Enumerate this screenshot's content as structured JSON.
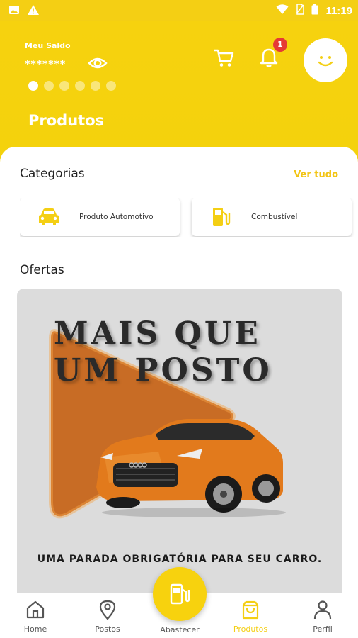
{
  "status_bar": {
    "time": "11:19"
  },
  "header": {
    "saldo_label": "Meu Saldo",
    "saldo_value": "*******",
    "notification_count": "1",
    "page_title": "Produtos",
    "carousel_total": 6,
    "carousel_active": 1
  },
  "categories": {
    "title": "Categorias",
    "see_all": "Ver tudo",
    "items": [
      {
        "label": "Produto Automotivo",
        "icon": "car-icon"
      },
      {
        "label": "Combustível",
        "icon": "fuel-pump-icon"
      }
    ]
  },
  "offers": {
    "title": "Ofertas",
    "banner_headline_line1": "MAIS QUE",
    "banner_headline_line2": "UM POSTO",
    "banner_caption": "UMA PARADA OBRIGATÓRIA PARA SEU CARRO."
  },
  "bottom_nav": {
    "items": [
      {
        "label": "Home",
        "icon": "home-icon"
      },
      {
        "label": "Postos",
        "icon": "location-pin-icon"
      },
      {
        "label": "Abastecer",
        "icon": "fuel-pump-icon"
      },
      {
        "label": "Produtos",
        "icon": "shopping-bag-icon",
        "active": true
      },
      {
        "label": "Perfil",
        "icon": "person-icon"
      }
    ]
  },
  "colors": {
    "brand_yellow": "#f4cf14",
    "badge_red": "#e53935",
    "banner_orange": "#c6651a"
  }
}
